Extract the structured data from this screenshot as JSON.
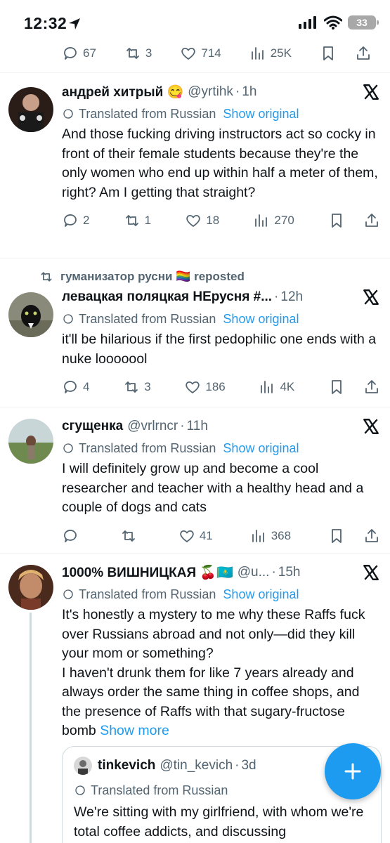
{
  "status": {
    "time": "12:32",
    "battery": "33"
  },
  "top_actions": {
    "reply": "67",
    "retweet": "3",
    "like": "714",
    "views": "25K"
  },
  "tweets": [
    {
      "name": "андрей хитрый 😋",
      "handle": "@yrtihk",
      "sep": "·",
      "time": "1h",
      "translated": "Translated from Russian",
      "show_original": "Show original",
      "text": "And those fucking driving instructors act so cocky in front of their female students because they're the only women who end up within half a meter of them, right? Am I getting that straight?",
      "reply": "2",
      "retweet": "1",
      "like": "18",
      "views": "270"
    },
    {
      "reposted_by": "гуманизатор русни 🏳️‍🌈 reposted",
      "name": "левацкая поляцкая НЕрусня #...",
      "handle": "",
      "sep": "·",
      "time": "12h",
      "translated": "Translated from Russian",
      "show_original": "Show original",
      "text": "it'll be hilarious if the first pedophilic one ends with a nuke looooool",
      "reply": "4",
      "retweet": "3",
      "like": "186",
      "views": "4K"
    },
    {
      "name": "сгущенка",
      "handle": "@vrlrncr",
      "sep": "·",
      "time": "11h",
      "translated": "Translated from Russian",
      "show_original": "Show original",
      "text": "I will definitely grow up and become a cool researcher and teacher with a healthy head and a couple of dogs and cats",
      "reply": "",
      "retweet": "",
      "like": "41",
      "views": "368"
    },
    {
      "name": "1000% ВИШНИЦКАЯ 🍒🇰🇿",
      "handle": "@u...",
      "sep": "·",
      "time": "15h",
      "translated": "Translated from Russian",
      "show_original": "Show original",
      "text": "It's honestly a mystery to me why these Raffs fuck over Russians abroad and not only—did they kill your mom or something?\nI haven't drunk them for like 7 years already and always order the same thing in coffee shops, and the presence of Raffs with that sugary-fructose bomb",
      "show_more": "Show more"
    }
  ],
  "quote": {
    "name": "tinkevich",
    "handle": "@tin_kevich",
    "sep": "·",
    "time": "3d",
    "translated": "Translated from Russian",
    "text": "We're sitting with my girlfriend, with whom we're total coffee addicts, and discussing"
  },
  "colors": {
    "accent": "#1d9bf0",
    "muted": "#536471",
    "text": "#0f1419",
    "border": "#eff3f4"
  }
}
